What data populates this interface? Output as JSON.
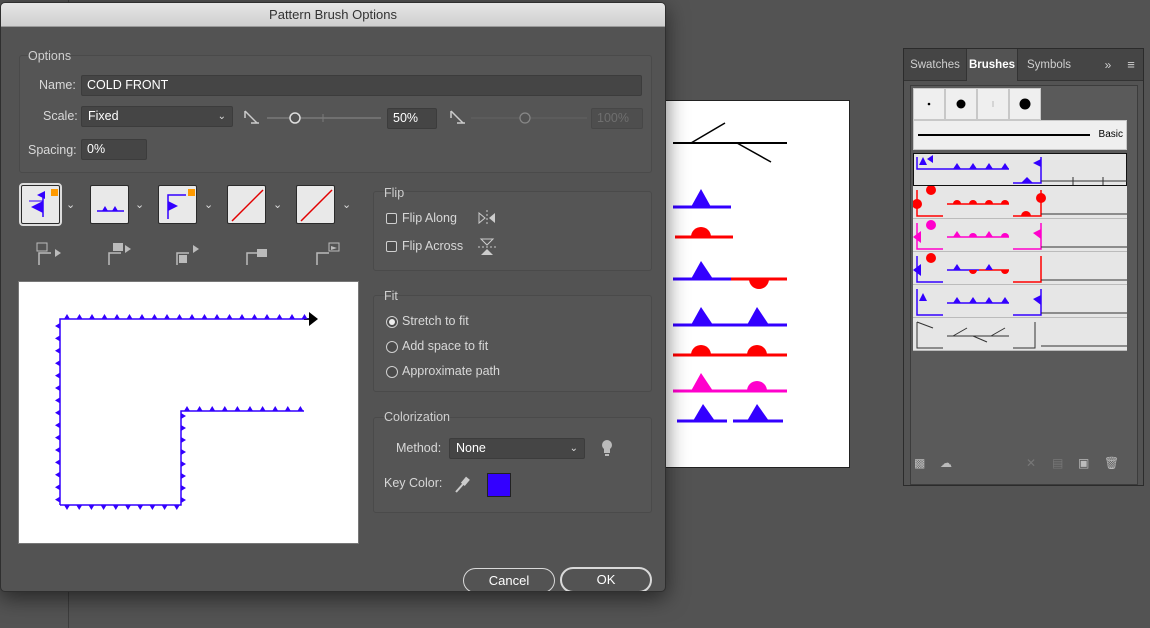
{
  "dialog": {
    "title": "Pattern Brush Options",
    "options_label": "Options",
    "name_label": "Name:",
    "name_value": "COLD FRONT",
    "scale_label": "Scale:",
    "scale_mode": "Fixed",
    "scale_value": "50%",
    "scale_max_value": "100%",
    "spacing_label": "Spacing:",
    "spacing_value": "0%",
    "flip": {
      "label": "Flip",
      "along": "Flip Along",
      "across": "Flip Across"
    },
    "fit": {
      "label": "Fit",
      "options": [
        "Stretch to fit",
        "Add space to fit",
        "Approximate path"
      ],
      "selected": "Stretch to fit"
    },
    "colorization": {
      "label": "Colorization",
      "method_label": "Method:",
      "method_value": "None",
      "key_color_label": "Key Color:",
      "key_color": "#3300ff"
    },
    "cancel_label": "Cancel",
    "ok_label": "OK"
  },
  "brushes_panel": {
    "tabs": [
      "Swatches",
      "Brushes",
      "Symbols"
    ],
    "active_tab": "Brushes",
    "basic_label": "Basic",
    "accent_blue": "#3300ff",
    "accent_red": "#ff0000",
    "accent_magenta": "#ff00cc"
  }
}
